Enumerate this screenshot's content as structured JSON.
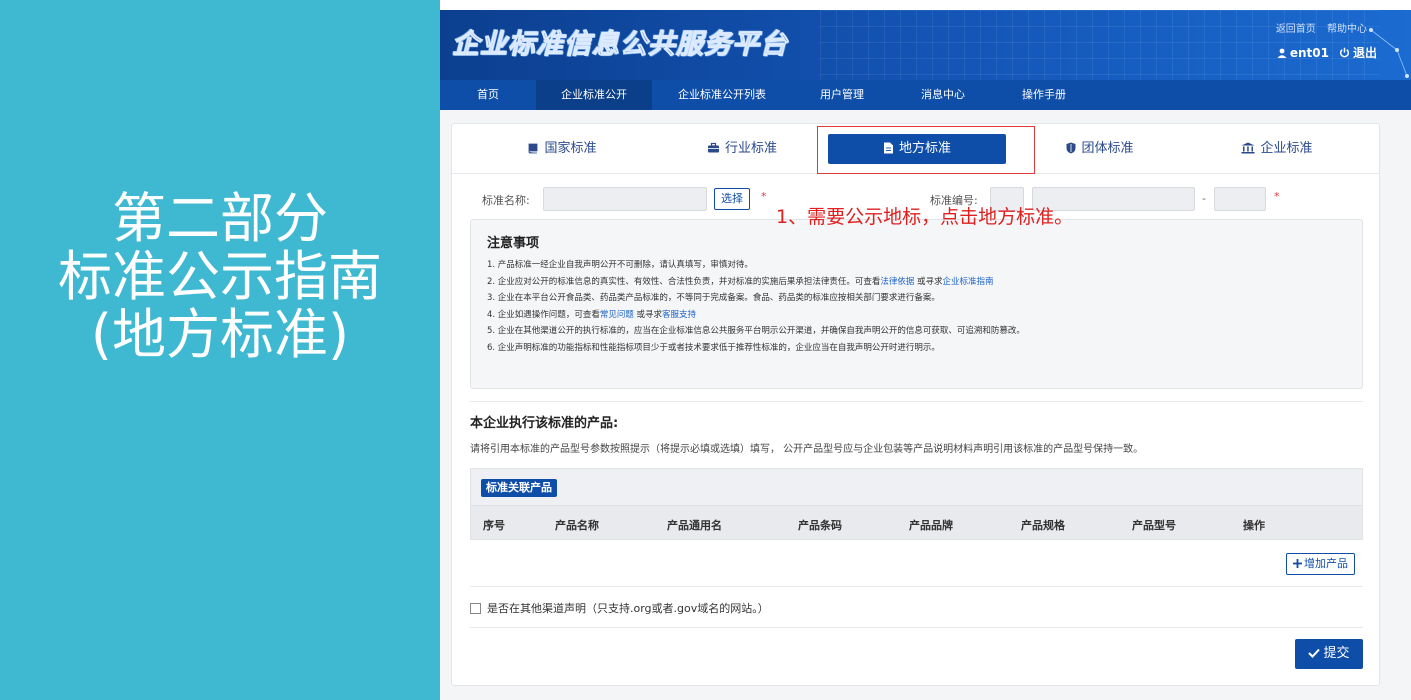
{
  "slide": {
    "title_lines": [
      "第二部分",
      "标准公示指南",
      "(地方标准)"
    ]
  },
  "header": {
    "brand": "企业标准信息公共服务平台",
    "top_links": [
      "返回首页",
      "帮助中心"
    ],
    "username": "ent01",
    "logout": "退出"
  },
  "nav": {
    "items": [
      "首页",
      "企业标准公开",
      "企业标准公开列表",
      "用户管理",
      "消息中心",
      "操作手册"
    ],
    "active_index": 1
  },
  "tabs": {
    "items": [
      {
        "label": "国家标准",
        "icon": "book-icon"
      },
      {
        "label": "行业标准",
        "icon": "briefcase-icon"
      },
      {
        "label": "地方标准",
        "icon": "document-icon"
      },
      {
        "label": "团体标准",
        "icon": "shield-icon"
      },
      {
        "label": "企业标准",
        "icon": "bank-icon"
      }
    ],
    "active_index": 2
  },
  "form": {
    "standard_name_label": "标准名称:",
    "select_button": "选择",
    "required_mark": "*",
    "standard_code_label": "标准编号:",
    "dash": "-"
  },
  "annotation": "1、需要公示地标，点击地方标准。",
  "notice": {
    "title": "注意事项",
    "item1": "1. 产品标准一经企业自我声明公开不可删除，请认真填写，审慎对待。",
    "item2_pre": "2. 企业应对公开的标准信息的真实性、有效性、合法性负责，并对标准的实施后果承担法律责任。可查看",
    "item2_link1": "法律依据",
    "item2_mid": " 或寻求",
    "item2_link2": "企业标准指南",
    "item3": "3. 企业在本平台公开食品类、药品类产品标准的，不等同于完成备案。食品、药品类的标准应按相关部门要求进行备案。",
    "item4_pre": "4. 企业如遇操作问题，可查看",
    "item4_link1": "常见问题",
    "item4_mid": " 或寻求",
    "item4_link2": "客服支持",
    "item5": "5. 企业在其他渠道公开的执行标准的，应当在企业标准信息公共服务平台明示公开渠道，并确保自我声明公开的信息可获取、可追溯和防篡改。",
    "item6": "6. 企业声明标准的功能指标和性能指标项目少于或者技术要求低于推荐性标准的，企业应当在自我声明公开时进行明示。"
  },
  "products": {
    "title": "本企业执行该标准的产品:",
    "description": "请将引用本标准的产品型号参数按照提示（将提示必填或选填）填写， 公开产品型号应与企业包装等产品说明材料声明引用该标准的产品型号保持一致。",
    "tag": "标准关联产品",
    "columns": [
      "序号",
      "产品名称",
      "产品通用名",
      "产品条码",
      "产品品牌",
      "产品规格",
      "产品型号",
      "操作"
    ],
    "add_button": "增加产品"
  },
  "other_channel_label": "是否在其他渠道声明（只支持.org或者.gov域名的网站。）",
  "submit_button": "提交"
}
